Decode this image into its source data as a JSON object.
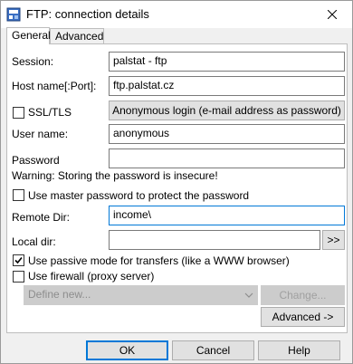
{
  "window": {
    "title": "FTP: connection details",
    "close_icon": "close-icon"
  },
  "tabs": [
    {
      "label": "General",
      "active": true
    },
    {
      "label": "Advanced",
      "active": false
    }
  ],
  "session": {
    "label": "Session:",
    "value": "palstat - ftp"
  },
  "host": {
    "label": "Host name[:Port]:",
    "value": "ftp.palstat.cz"
  },
  "ssl": {
    "label": "SSL/TLS",
    "checked": false
  },
  "anon_button": "Anonymous login (e-mail address as password)",
  "user": {
    "label": "User name:",
    "value": "anonymous"
  },
  "password": {
    "label": "Password",
    "value": "",
    "warning": "Warning: Storing the password is insecure!"
  },
  "master_password": {
    "label": "Use master password to protect the password",
    "checked": false
  },
  "remote_dir": {
    "label": "Remote Dir:",
    "value": "income\\"
  },
  "local_dir": {
    "label": "Local dir:",
    "value": "",
    "browse_label": ">>"
  },
  "passive": {
    "label": "Use passive mode for transfers (like a WWW browser)",
    "checked": true
  },
  "firewall": {
    "label": "Use firewall (proxy server)",
    "checked": false
  },
  "firewall_combo": {
    "value": "Define new..."
  },
  "change_button": "Change...",
  "advanced_button": "Advanced ->",
  "footer": {
    "ok": "OK",
    "cancel": "Cancel",
    "help": "Help"
  },
  "colors": {
    "accent": "#0078d7",
    "face": "#f0f0f0",
    "disabled": "#cccccc"
  }
}
